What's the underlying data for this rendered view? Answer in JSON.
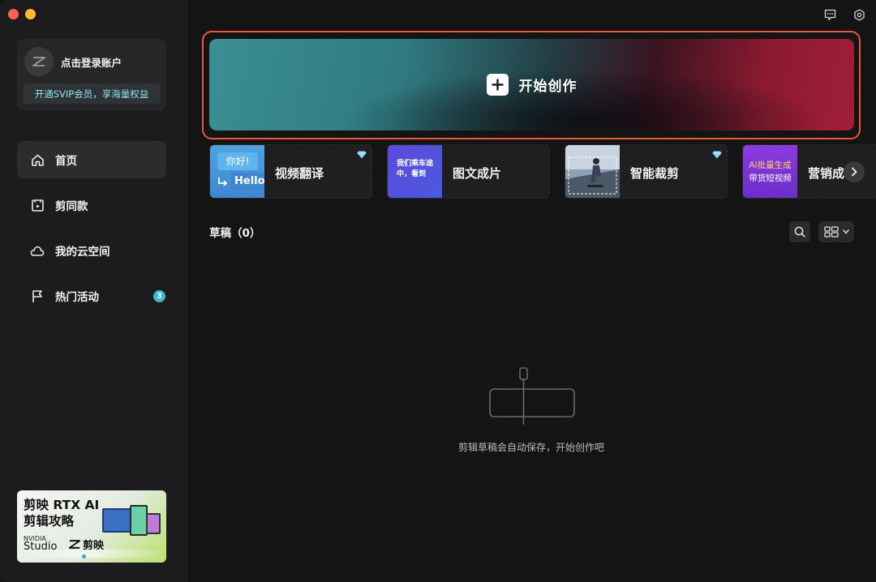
{
  "account": {
    "login_label": "点击登录账户",
    "vip_label": "开通SVIP会员，享海量权益"
  },
  "nav": {
    "items": [
      {
        "label": "首页",
        "icon": "home-icon"
      },
      {
        "label": "剪同款",
        "icon": "template-icon"
      },
      {
        "label": "我的云空间",
        "icon": "cloud-icon"
      },
      {
        "label": "热门活动",
        "icon": "flag-icon",
        "badge": "3"
      }
    ]
  },
  "promo": {
    "title_line1": "剪映 RTX AI",
    "title_line2": "剪辑攻略",
    "brand": "NVIDIA",
    "studio": "Studio",
    "app": "剪映"
  },
  "header": {
    "icons": [
      "feedback-icon",
      "settings-icon"
    ]
  },
  "create": {
    "label": "开始创作"
  },
  "features": [
    {
      "label": "视频翻译",
      "thumb_text_1": "你好!",
      "thumb_text_2": "Hello",
      "pro": true
    },
    {
      "label": "图文成片",
      "thumb_text_1": "我们乘车途中，看到",
      "pro": false
    },
    {
      "label": "智能裁剪",
      "pro": true
    },
    {
      "label": "营销成",
      "thumb_text_1": "AI批量生成",
      "thumb_text_2": "带货短视频",
      "pro": false
    }
  ],
  "drafts": {
    "title": "草稿（0）",
    "empty_text": "剪辑草稿会自动保存，开始创作吧"
  },
  "colors": {
    "accent_outline": "#e8573a",
    "vip_text": "#8fe3ef",
    "badge": "#3cb8c8"
  }
}
